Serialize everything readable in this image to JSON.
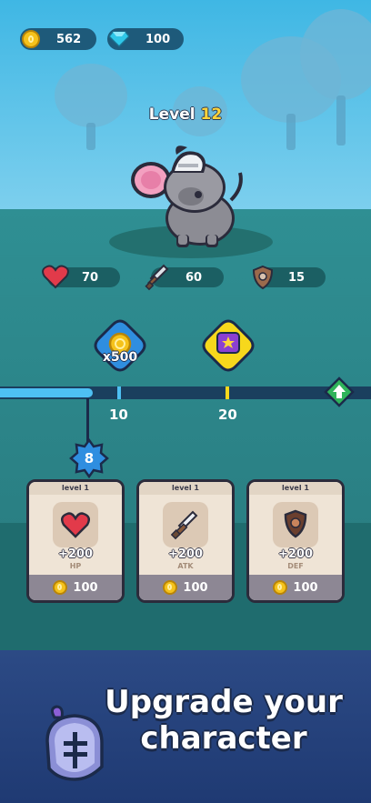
{
  "currency": {
    "coins": "562",
    "gems": "100"
  },
  "character": {
    "level_label": "Level",
    "level_value": "12"
  },
  "stats": {
    "hp": "70",
    "attack": "60",
    "defense": "15"
  },
  "rewards": {
    "coin_reward_amount": "x500",
    "milestones": [
      "10",
      "20"
    ],
    "current_level_badge": "8"
  },
  "cards": [
    {
      "level": "level 1",
      "value": "+200",
      "stat": "HP",
      "cost": "100",
      "icon": "heart-icon"
    },
    {
      "level": "level 1",
      "value": "+200",
      "stat": "ATK",
      "cost": "100",
      "icon": "sword-icon"
    },
    {
      "level": "level 1",
      "value": "+200",
      "stat": "DEF",
      "cost": "100",
      "icon": "shield-icon"
    }
  ],
  "headline": {
    "line1": "Upgrade your",
    "line2": "character"
  },
  "colors": {
    "coin": "#f5c21b",
    "gem": "#2fc7e8",
    "accent_blue": "#4ec0f3",
    "banner": "#2c4a85"
  },
  "progress": {
    "fill_fraction": 0.25
  }
}
